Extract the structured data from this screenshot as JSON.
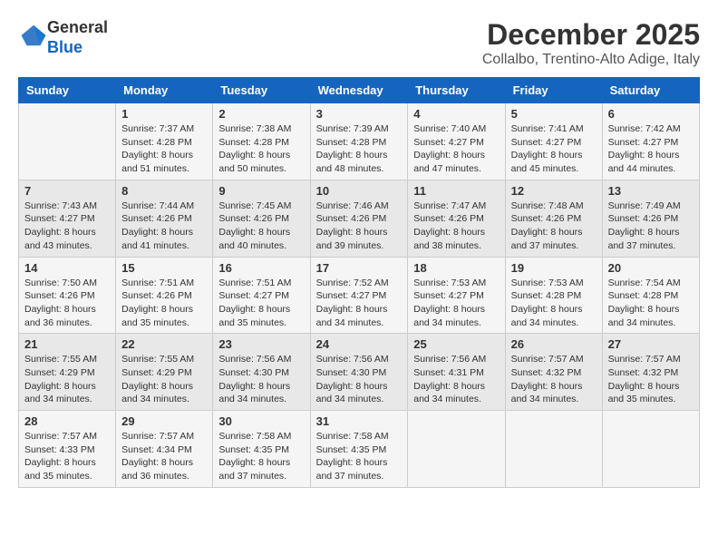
{
  "header": {
    "logo_line1": "General",
    "logo_line2": "Blue",
    "month_title": "December 2025",
    "location": "Collalbo, Trentino-Alto Adige, Italy"
  },
  "days_of_week": [
    "Sunday",
    "Monday",
    "Tuesday",
    "Wednesday",
    "Thursday",
    "Friday",
    "Saturday"
  ],
  "weeks": [
    [
      {
        "day": "",
        "sunrise": "",
        "sunset": "",
        "daylight": ""
      },
      {
        "day": "1",
        "sunrise": "Sunrise: 7:37 AM",
        "sunset": "Sunset: 4:28 PM",
        "daylight": "Daylight: 8 hours and 51 minutes."
      },
      {
        "day": "2",
        "sunrise": "Sunrise: 7:38 AM",
        "sunset": "Sunset: 4:28 PM",
        "daylight": "Daylight: 8 hours and 50 minutes."
      },
      {
        "day": "3",
        "sunrise": "Sunrise: 7:39 AM",
        "sunset": "Sunset: 4:28 PM",
        "daylight": "Daylight: 8 hours and 48 minutes."
      },
      {
        "day": "4",
        "sunrise": "Sunrise: 7:40 AM",
        "sunset": "Sunset: 4:27 PM",
        "daylight": "Daylight: 8 hours and 47 minutes."
      },
      {
        "day": "5",
        "sunrise": "Sunrise: 7:41 AM",
        "sunset": "Sunset: 4:27 PM",
        "daylight": "Daylight: 8 hours and 45 minutes."
      },
      {
        "day": "6",
        "sunrise": "Sunrise: 7:42 AM",
        "sunset": "Sunset: 4:27 PM",
        "daylight": "Daylight: 8 hours and 44 minutes."
      }
    ],
    [
      {
        "day": "7",
        "sunrise": "Sunrise: 7:43 AM",
        "sunset": "Sunset: 4:27 PM",
        "daylight": "Daylight: 8 hours and 43 minutes."
      },
      {
        "day": "8",
        "sunrise": "Sunrise: 7:44 AM",
        "sunset": "Sunset: 4:26 PM",
        "daylight": "Daylight: 8 hours and 41 minutes."
      },
      {
        "day": "9",
        "sunrise": "Sunrise: 7:45 AM",
        "sunset": "Sunset: 4:26 PM",
        "daylight": "Daylight: 8 hours and 40 minutes."
      },
      {
        "day": "10",
        "sunrise": "Sunrise: 7:46 AM",
        "sunset": "Sunset: 4:26 PM",
        "daylight": "Daylight: 8 hours and 39 minutes."
      },
      {
        "day": "11",
        "sunrise": "Sunrise: 7:47 AM",
        "sunset": "Sunset: 4:26 PM",
        "daylight": "Daylight: 8 hours and 38 minutes."
      },
      {
        "day": "12",
        "sunrise": "Sunrise: 7:48 AM",
        "sunset": "Sunset: 4:26 PM",
        "daylight": "Daylight: 8 hours and 37 minutes."
      },
      {
        "day": "13",
        "sunrise": "Sunrise: 7:49 AM",
        "sunset": "Sunset: 4:26 PM",
        "daylight": "Daylight: 8 hours and 37 minutes."
      }
    ],
    [
      {
        "day": "14",
        "sunrise": "Sunrise: 7:50 AM",
        "sunset": "Sunset: 4:26 PM",
        "daylight": "Daylight: 8 hours and 36 minutes."
      },
      {
        "day": "15",
        "sunrise": "Sunrise: 7:51 AM",
        "sunset": "Sunset: 4:26 PM",
        "daylight": "Daylight: 8 hours and 35 minutes."
      },
      {
        "day": "16",
        "sunrise": "Sunrise: 7:51 AM",
        "sunset": "Sunset: 4:27 PM",
        "daylight": "Daylight: 8 hours and 35 minutes."
      },
      {
        "day": "17",
        "sunrise": "Sunrise: 7:52 AM",
        "sunset": "Sunset: 4:27 PM",
        "daylight": "Daylight: 8 hours and 34 minutes."
      },
      {
        "day": "18",
        "sunrise": "Sunrise: 7:53 AM",
        "sunset": "Sunset: 4:27 PM",
        "daylight": "Daylight: 8 hours and 34 minutes."
      },
      {
        "day": "19",
        "sunrise": "Sunrise: 7:53 AM",
        "sunset": "Sunset: 4:28 PM",
        "daylight": "Daylight: 8 hours and 34 minutes."
      },
      {
        "day": "20",
        "sunrise": "Sunrise: 7:54 AM",
        "sunset": "Sunset: 4:28 PM",
        "daylight": "Daylight: 8 hours and 34 minutes."
      }
    ],
    [
      {
        "day": "21",
        "sunrise": "Sunrise: 7:55 AM",
        "sunset": "Sunset: 4:29 PM",
        "daylight": "Daylight: 8 hours and 34 minutes."
      },
      {
        "day": "22",
        "sunrise": "Sunrise: 7:55 AM",
        "sunset": "Sunset: 4:29 PM",
        "daylight": "Daylight: 8 hours and 34 minutes."
      },
      {
        "day": "23",
        "sunrise": "Sunrise: 7:56 AM",
        "sunset": "Sunset: 4:30 PM",
        "daylight": "Daylight: 8 hours and 34 minutes."
      },
      {
        "day": "24",
        "sunrise": "Sunrise: 7:56 AM",
        "sunset": "Sunset: 4:30 PM",
        "daylight": "Daylight: 8 hours and 34 minutes."
      },
      {
        "day": "25",
        "sunrise": "Sunrise: 7:56 AM",
        "sunset": "Sunset: 4:31 PM",
        "daylight": "Daylight: 8 hours and 34 minutes."
      },
      {
        "day": "26",
        "sunrise": "Sunrise: 7:57 AM",
        "sunset": "Sunset: 4:32 PM",
        "daylight": "Daylight: 8 hours and 34 minutes."
      },
      {
        "day": "27",
        "sunrise": "Sunrise: 7:57 AM",
        "sunset": "Sunset: 4:32 PM",
        "daylight": "Daylight: 8 hours and 35 minutes."
      }
    ],
    [
      {
        "day": "28",
        "sunrise": "Sunrise: 7:57 AM",
        "sunset": "Sunset: 4:33 PM",
        "daylight": "Daylight: 8 hours and 35 minutes."
      },
      {
        "day": "29",
        "sunrise": "Sunrise: 7:57 AM",
        "sunset": "Sunset: 4:34 PM",
        "daylight": "Daylight: 8 hours and 36 minutes."
      },
      {
        "day": "30",
        "sunrise": "Sunrise: 7:58 AM",
        "sunset": "Sunset: 4:35 PM",
        "daylight": "Daylight: 8 hours and 37 minutes."
      },
      {
        "day": "31",
        "sunrise": "Sunrise: 7:58 AM",
        "sunset": "Sunset: 4:35 PM",
        "daylight": "Daylight: 8 hours and 37 minutes."
      },
      {
        "day": "",
        "sunrise": "",
        "sunset": "",
        "daylight": ""
      },
      {
        "day": "",
        "sunrise": "",
        "sunset": "",
        "daylight": ""
      },
      {
        "day": "",
        "sunrise": "",
        "sunset": "",
        "daylight": ""
      }
    ]
  ]
}
